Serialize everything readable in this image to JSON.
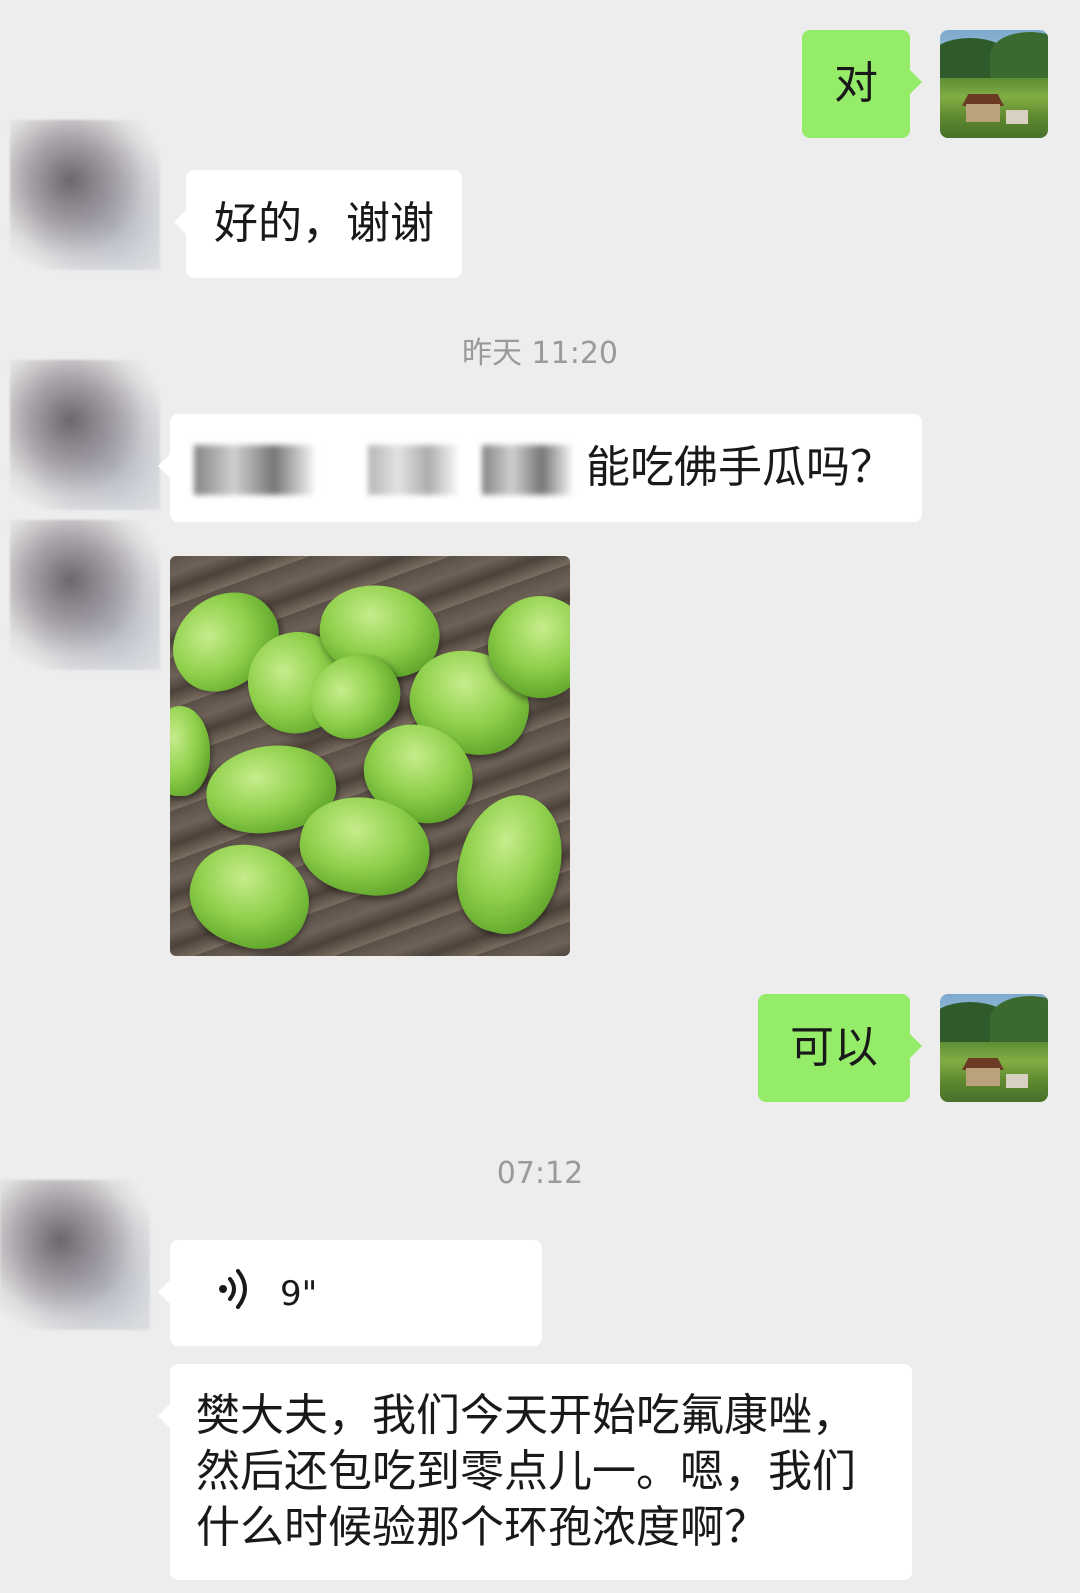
{
  "messages": {
    "m1_text": "对",
    "m2_text": "好的，谢谢",
    "ts1": "昨天 11:20",
    "m3_text": "能吃佛手瓜吗？",
    "m5_text": "可以",
    "ts2": "07:12",
    "voice_duration": "9\"",
    "m7_text": "樊大夫，我们今天开始吃氟康唑，然后还包吃到零点儿一。嗯，我们什么时候验那个环孢浓度啊？"
  },
  "colors": {
    "background": "#ededed",
    "bubble_out": "#95ec69",
    "bubble_in": "#ffffff",
    "timestamp": "#9a9a9a"
  },
  "icons": {
    "voice": "voice-wave-icon"
  }
}
